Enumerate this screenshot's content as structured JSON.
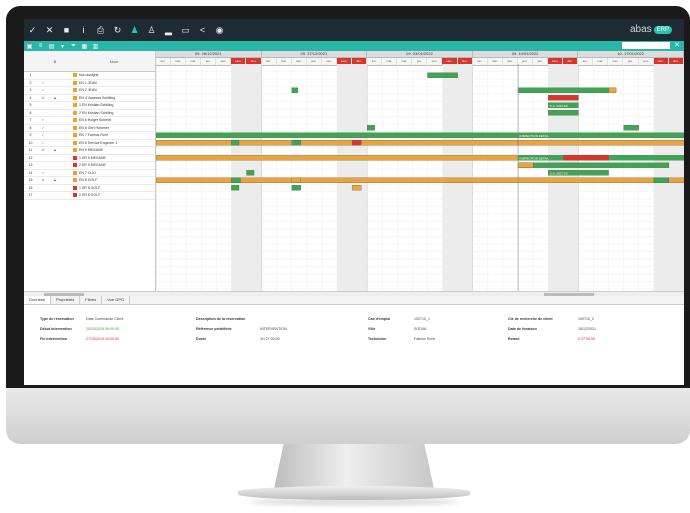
{
  "toolbar": {
    "icons": [
      "check-icon",
      "close-icon",
      "stop-icon",
      "info-icon",
      "print-icon",
      "refresh-icon",
      "user-icon",
      "person-icon",
      "chart-icon",
      "monitor-icon",
      "share-icon",
      "camera-icon"
    ],
    "glyphs": [
      "✓",
      "✕",
      "■",
      "i",
      "⎙",
      "↻",
      "♟",
      "♙",
      "▂",
      "▭",
      "<",
      "◉"
    ],
    "logo_text": "abas",
    "logo_badge": "ERP"
  },
  "toolbar2": {
    "glyphs": [
      "▣",
      "≡",
      "▤",
      "▾",
      "⏷",
      "▦",
      "▥"
    ],
    "search_placeholder": "",
    "close_glyph": "✕"
  },
  "left_header": {
    "col_num": "",
    "col_a": "",
    "col_b": "B",
    "col_c": "",
    "col_name": "Nom"
  },
  "rows": [
    {
      "n": "1",
      "c1": "",
      "c2": "",
      "c3": "",
      "name": "Non assigné",
      "icon": "person"
    },
    {
      "n": "2",
      "c1": "✓",
      "c2": "",
      "c3": "",
      "name": "EN 1 JEAN",
      "icon": "person"
    },
    {
      "n": "3",
      "c1": "✓",
      "c2": "",
      "c3": "",
      "name": "EN 2 JEAN",
      "icon": "person"
    },
    {
      "n": "4",
      "c1": "⊘",
      "c2": "▲",
      "c3": "",
      "name": "EN 4 Vanessa Schilling",
      "icon": "person"
    },
    {
      "n": "5",
      "c1": "",
      "c2": "",
      "c3": "",
      "name": "1 EN Kristian Schilling",
      "icon": "person"
    },
    {
      "n": "6",
      "c1": "",
      "c2": "",
      "c3": "",
      "name": "2 EN Kristian Schilling",
      "icon": "person"
    },
    {
      "n": "7",
      "c1": "✓",
      "c2": "",
      "c3": "",
      "name": "EN 6 Holger Schmitt",
      "icon": "person"
    },
    {
      "n": "8",
      "c1": "✓",
      "c2": "",
      "c3": "",
      "name": "EN 6 Gert Hammer",
      "icon": "person"
    },
    {
      "n": "9",
      "c1": "✓",
      "c2": "",
      "c3": "",
      "name": "EN 7 Fatmus Rohr",
      "icon": "person"
    },
    {
      "n": "10",
      "c1": "✓",
      "c2": "",
      "c3": "",
      "name": "EN 8 Service Engineer 1",
      "icon": "person"
    },
    {
      "n": "11",
      "c1": "⊘",
      "c2": "▲",
      "c3": "",
      "name": "EN 9 MEGANE",
      "icon": "person"
    },
    {
      "n": "12",
      "c1": "",
      "c2": "",
      "c3": "",
      "name": "1 SR 9 MEGANE",
      "icon": "tool"
    },
    {
      "n": "13",
      "c1": "",
      "c2": "",
      "c3": "",
      "name": "2 SR 9 MEGANE",
      "icon": "tool"
    },
    {
      "n": "14",
      "c1": "✓",
      "c2": "",
      "c3": "",
      "name": "EN 7 CLIO",
      "icon": "person"
    },
    {
      "n": "15",
      "c1": "⊘",
      "c2": "▲",
      "c3": "",
      "name": "EN 8 GOLF",
      "icon": "person"
    },
    {
      "n": "16",
      "c1": "",
      "c2": "",
      "c3": "",
      "name": "1 SR 8 GOLF",
      "icon": "tool"
    },
    {
      "n": "17",
      "c1": "",
      "c2": "",
      "c3": "",
      "name": "2 SR 8 GOLF",
      "icon": "tool"
    }
  ],
  "weeks": [
    "09. 26/12/2021",
    "09. 27/12/2021",
    "09. 03/01/2022",
    "09. 10/01/2022",
    "10. 17/01/2022"
  ],
  "day_labels": [
    "lun.",
    "mar.",
    "mer.",
    "jeu.",
    "ven.",
    "sam.",
    "dim."
  ],
  "bar_labels": {
    "intervention": "INSPECTION DETAIL",
    "short": "C.A. 2017-00",
    "end": "INSPECTION DETAIL"
  },
  "tabs": [
    "Données",
    "Propriétés",
    "Filtres",
    "Vue GPG"
  ],
  "details": {
    "col1": [
      {
        "label": "Type de réservation",
        "value": "Date Commande Client",
        "tone": ""
      },
      {
        "label": "Début intervention",
        "value": "25/10/2019 09:00:00",
        "tone": "green"
      },
      {
        "label": "Fin intervention",
        "value": "27/10/2019 10:00:00",
        "tone": "red"
      }
    ],
    "col2": [
      {
        "label": "Description de la réservation",
        "value": "",
        "tone": ""
      },
      {
        "label": "Référence prédéfinie",
        "value": "INTERVENTION",
        "tone": ""
      },
      {
        "label": "Durée",
        "value": "1H 27:00:00",
        "tone": ""
      }
    ],
    "col3": [
      {
        "label": "Cas d'emploi",
        "value": "100710_1",
        "tone": ""
      },
      {
        "label": "Ville",
        "value": "SODIAL",
        "tone": ""
      },
      {
        "label": "Technicien",
        "value": "Fatmus Rohr",
        "tone": ""
      }
    ],
    "col4": [
      {
        "label": "Clé de recherche de client",
        "value": "100710_0",
        "tone": ""
      },
      {
        "label": "Date de livraison",
        "value": "15/12/2021",
        "tone": ""
      },
      {
        "label": "Retard",
        "value": "0 27:00:00",
        "tone": "red"
      }
    ]
  }
}
